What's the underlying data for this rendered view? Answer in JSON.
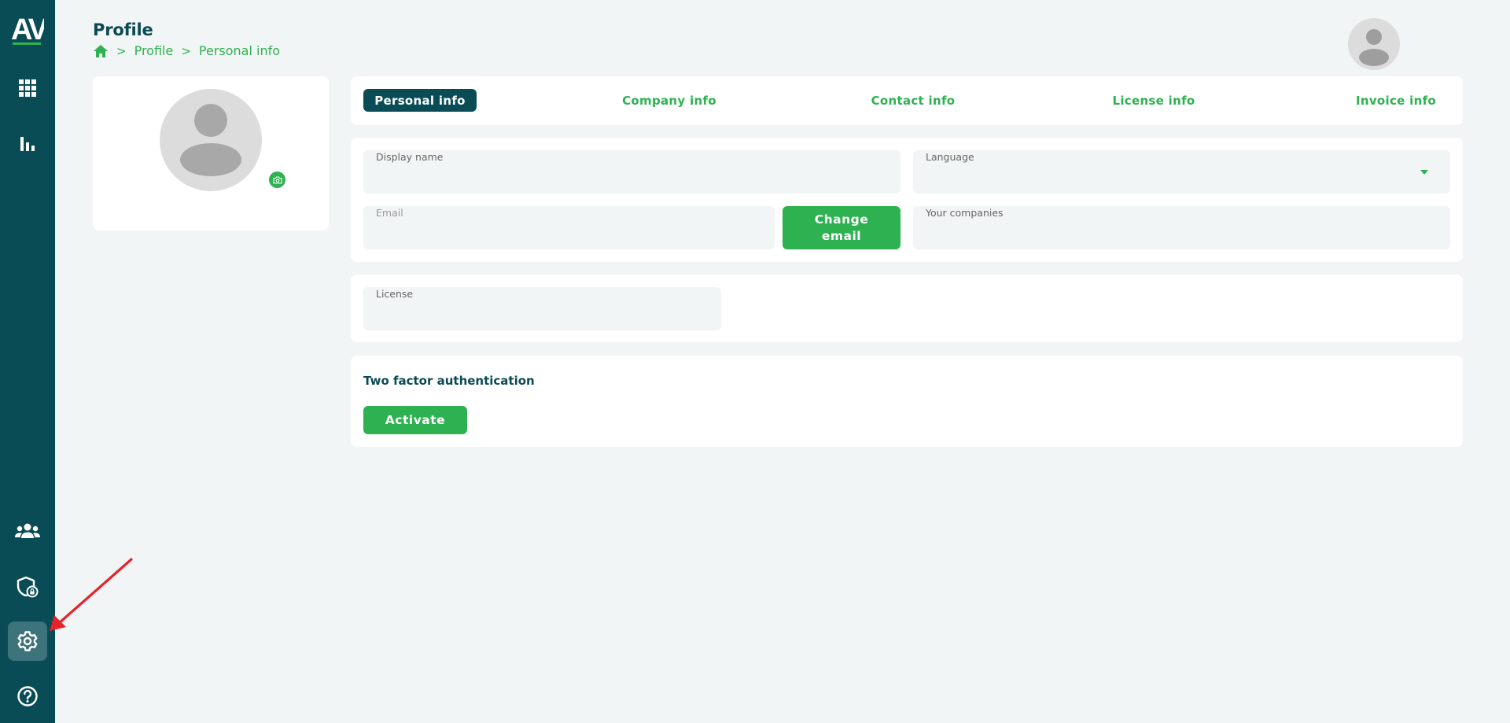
{
  "app": {
    "logo_text": "AV"
  },
  "header": {
    "title": "Profile",
    "breadcrumb": [
      "Profile",
      "Personal info"
    ]
  },
  "tabs": [
    {
      "label": "Personal info",
      "active": true
    },
    {
      "label": "Company info",
      "active": false
    },
    {
      "label": "Contact info",
      "active": false
    },
    {
      "label": "License info",
      "active": false
    },
    {
      "label": "Invoice info",
      "active": false
    }
  ],
  "form": {
    "display_name": {
      "label": "Display name",
      "value": ""
    },
    "language": {
      "label": "Language",
      "value": ""
    },
    "email": {
      "label": "Email",
      "value": ""
    },
    "change_email_label": "Change email",
    "your_companies": {
      "label": "Your companies",
      "value": ""
    }
  },
  "license": {
    "label": "License",
    "value": ""
  },
  "two_factor": {
    "title": "Two factor authentication",
    "activate_label": "Activate"
  },
  "sidebar": {
    "items": [
      {
        "name": "apps-grid-icon",
        "active": false
      },
      {
        "name": "bar-chart-icon",
        "active": false
      },
      {
        "name": "users-group-icon",
        "active": false
      },
      {
        "name": "shield-lock-icon",
        "active": false
      },
      {
        "name": "gear-icon",
        "active": true
      },
      {
        "name": "help-icon",
        "active": false
      }
    ]
  },
  "colors": {
    "sidebar": "#0a4c55",
    "accent_green": "#2eb150",
    "active_tab": "#0a4c55",
    "page_bg": "#f2f5f5",
    "annotation": "#e5232a"
  }
}
